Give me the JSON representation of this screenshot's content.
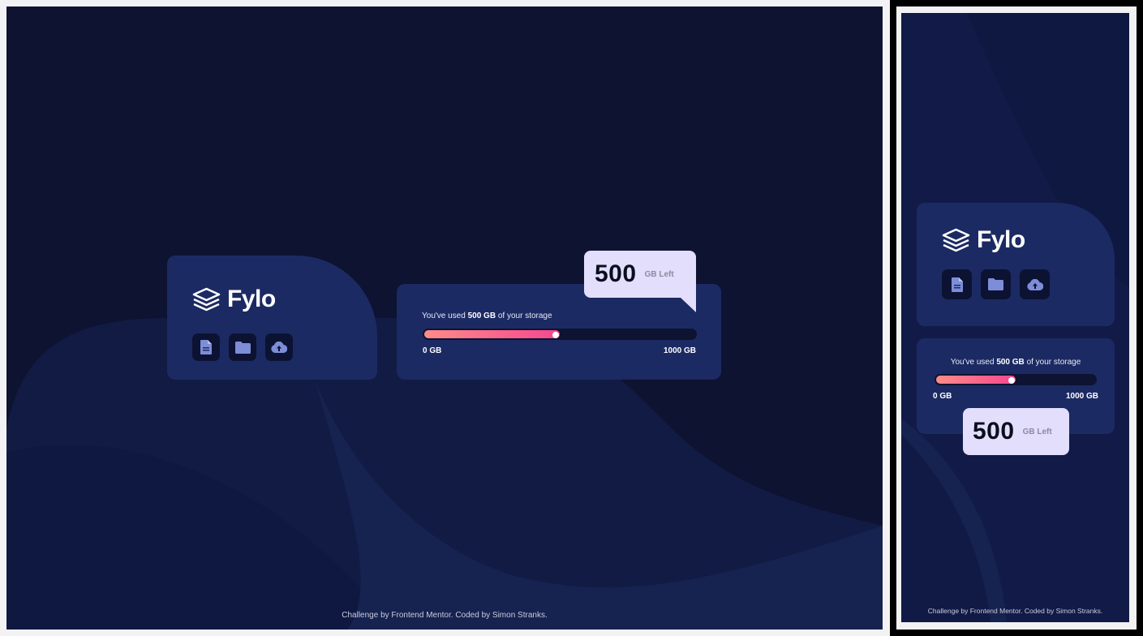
{
  "brand": {
    "name": "Fylo"
  },
  "icons": [
    "document-icon",
    "folder-icon",
    "upload-icon"
  ],
  "storage": {
    "used_prefix": "You've used",
    "used_amount": "500 GB",
    "used_suffix": "of your storage",
    "min_label": "0 GB",
    "max_label": "1000 GB",
    "used_fraction": 0.5,
    "remaining_value": "500",
    "remaining_unit": "GB Left"
  },
  "footer": {
    "attribution": "Challenge by Frontend Mentor. Coded by Simon Stranks."
  },
  "colors": {
    "background": "#0d1330",
    "card": "#1c2a63",
    "icon_button": "#0c1232",
    "gradient_start": "#fc8c8a",
    "gradient_end": "#f6478e",
    "callout": "#e2defb"
  }
}
